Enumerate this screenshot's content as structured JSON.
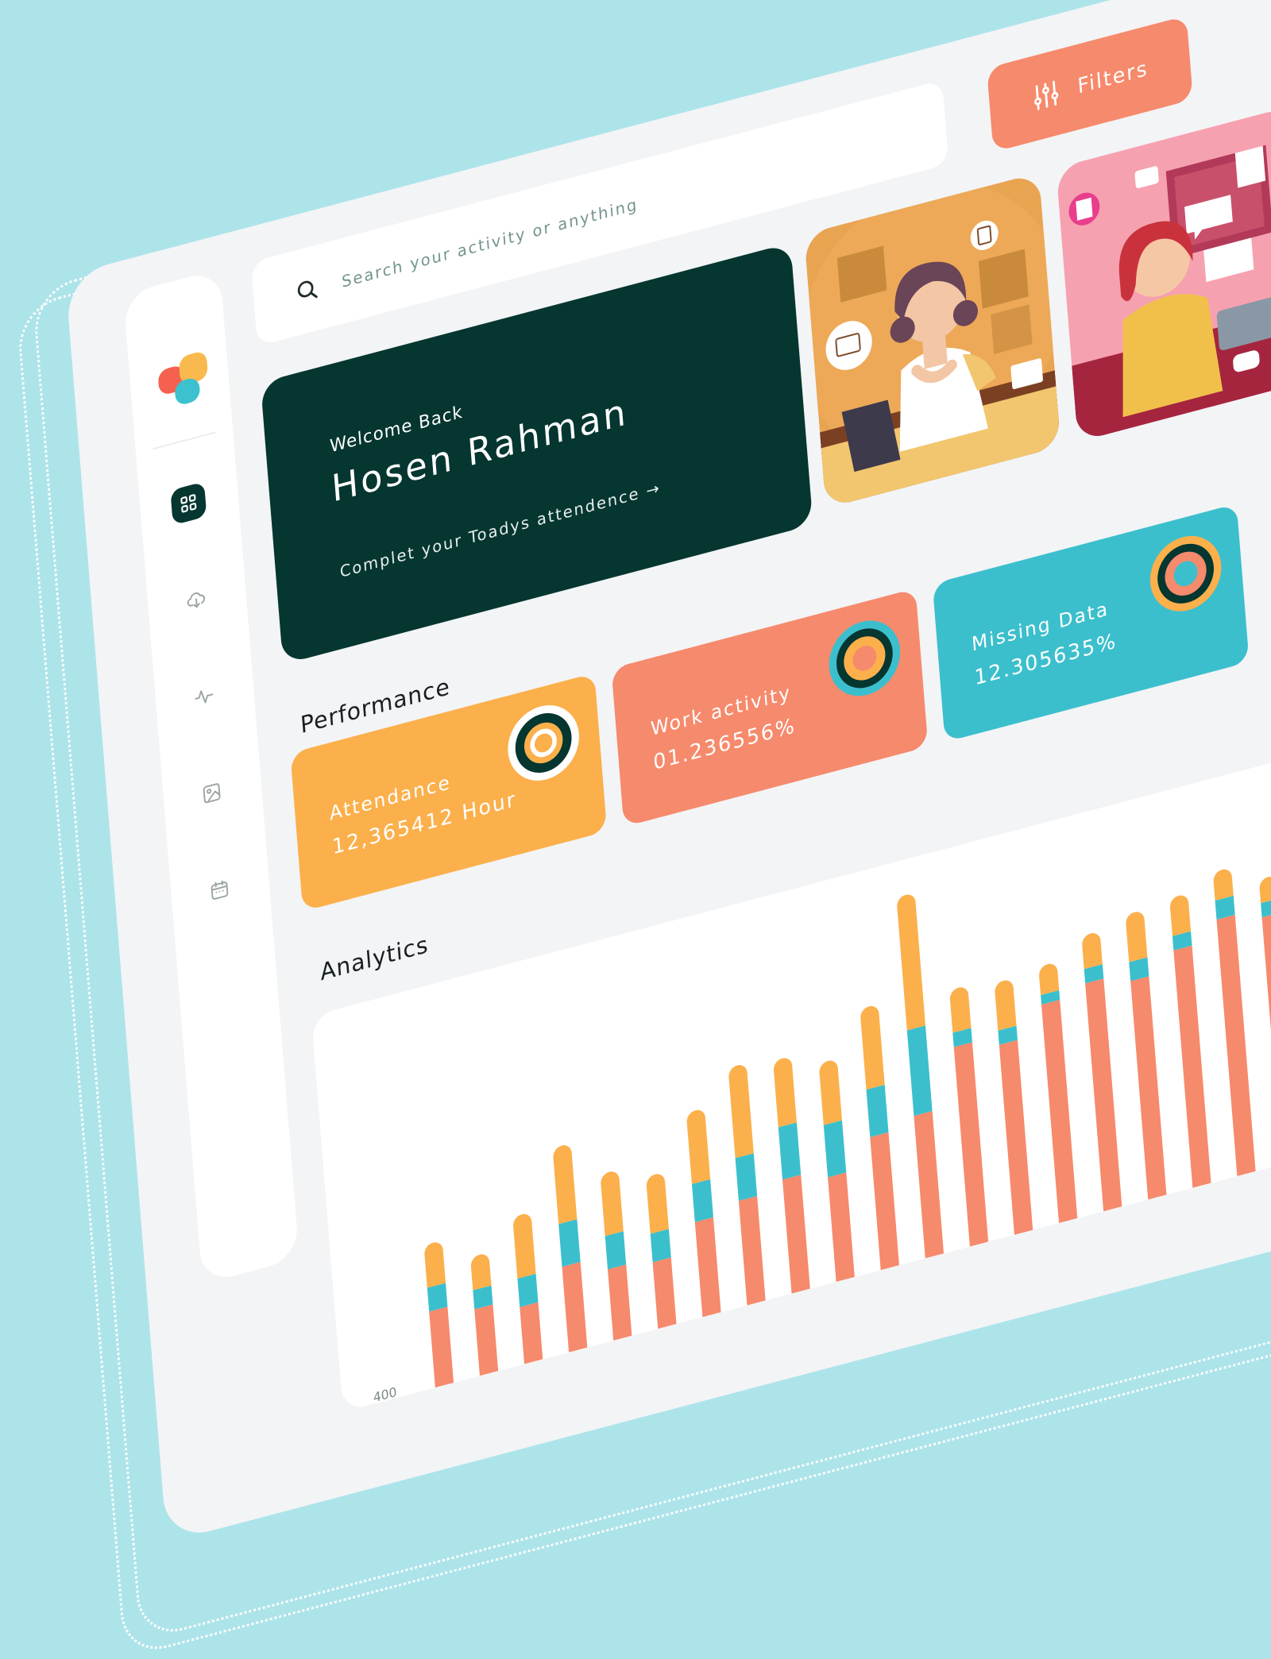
{
  "search": {
    "placeholder": "Search your activity or anything"
  },
  "filters": {
    "label": "Filters",
    "icon": "sliders-icon"
  },
  "sidebar": {
    "items": [
      {
        "name": "dashboard",
        "icon": "grid-icon",
        "active": true
      },
      {
        "name": "download",
        "icon": "cloud-download-icon",
        "active": false
      },
      {
        "name": "activity",
        "icon": "activity-icon",
        "active": false
      },
      {
        "name": "gallery",
        "icon": "image-icon",
        "active": false
      },
      {
        "name": "calendar",
        "icon": "calendar-icon",
        "active": false
      }
    ]
  },
  "welcome": {
    "greeting": "Welcome Back",
    "name": "Hosen Rahman",
    "cta": "Complet your Toadys attendence →"
  },
  "performance": {
    "title": "Performance",
    "cards": [
      {
        "label": "Attendance",
        "value": "12,365412 Hour",
        "color": "#fbb04c"
      },
      {
        "label": "Work activity",
        "value": "01.236556%",
        "color": "#f68a6c"
      },
      {
        "label": "Missing Data",
        "value": "12.305635%",
        "color": "#3cbfcd"
      }
    ]
  },
  "analytics": {
    "title": "Analytics"
  },
  "colors": {
    "accent_dark": "#053630",
    "orange": "#fbb04c",
    "coral": "#f68a6c",
    "teal": "#3cbfcd",
    "background": "#ade4ea"
  },
  "chart_data": {
    "type": "bar",
    "stacked": true,
    "visible_tick_labels": [
      "400"
    ],
    "series": [
      {
        "color": "#fbb04c",
        "values": [
          35,
          25,
          55,
          70,
          55,
          50,
          65,
          85,
          60,
          55,
          75,
          130,
          35,
          40,
          20,
          25,
          40,
          30,
          20,
          15
        ]
      },
      {
        "color": "#3cbfcd",
        "values": [
          25,
          20,
          30,
          45,
          35,
          30,
          40,
          45,
          55,
          55,
          50,
          90,
          15,
          15,
          10,
          15,
          20,
          15,
          20,
          15
        ]
      },
      {
        "color": "#f68a6c",
        "values": [
          80,
          70,
          60,
          90,
          75,
          70,
          100,
          110,
          120,
          110,
          140,
          150,
          210,
          200,
          230,
          240,
          230,
          250,
          270,
          260
        ]
      }
    ]
  }
}
